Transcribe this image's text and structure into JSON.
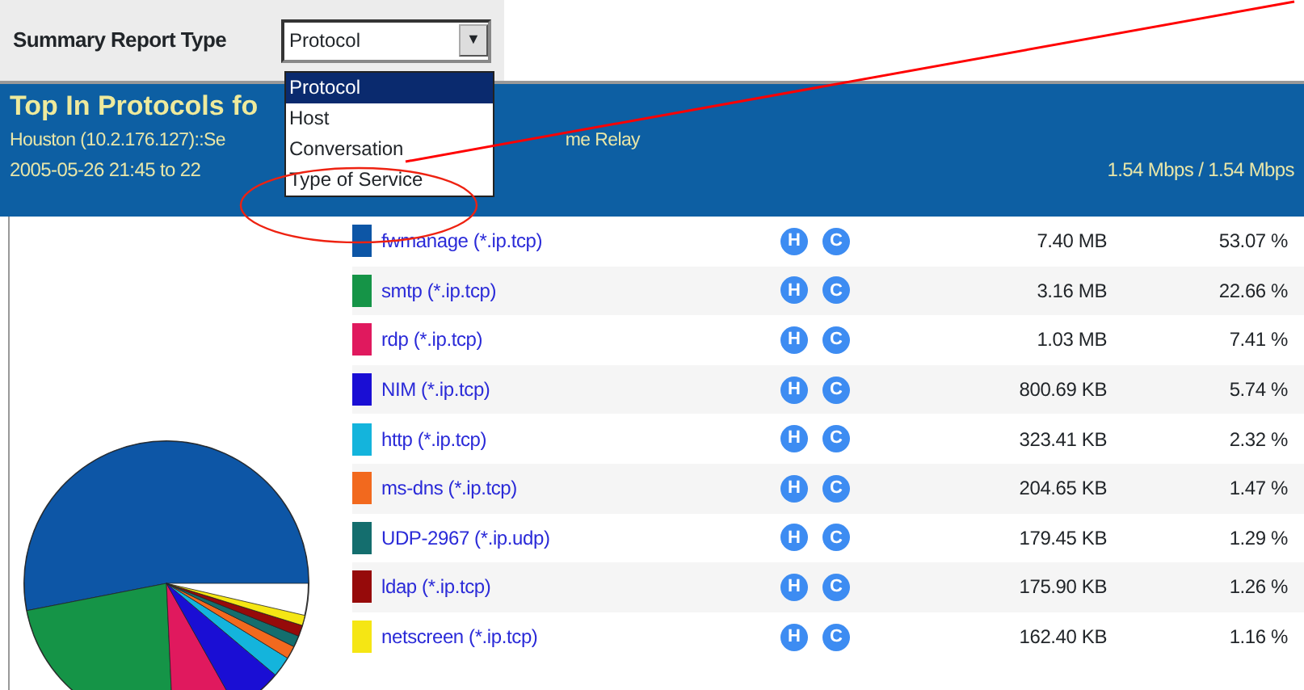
{
  "report_type": {
    "label": "Summary Report Type",
    "value": "Protocol",
    "arrow": "▼",
    "options": [
      {
        "label": "Protocol",
        "selected": true
      },
      {
        "label": "Host",
        "selected": false
      },
      {
        "label": "Conversation",
        "selected": false
      },
      {
        "label": "Type of Service",
        "selected": false
      }
    ]
  },
  "header": {
    "title": "Top In Protocols fo",
    "subtitle_left": "Houston (10.2.176.127)::Se",
    "subtitle_right": "me Relay",
    "date_range": "2005-05-26 21:45 to 22",
    "rate": "1.54 Mbps / 1.54 Mbps"
  },
  "rows": [
    {
      "name": "fwmanage (*.ip.tcp)",
      "color": "#0d56a6",
      "actions": [
        "H",
        "C"
      ],
      "volume": "7.40 MB",
      "percent": "53.07 %"
    },
    {
      "name": "smtp (*.ip.tcp)",
      "color": "#159447",
      "actions": [
        "H",
        "C"
      ],
      "volume": "3.16 MB",
      "percent": "22.66 %"
    },
    {
      "name": "rdp (*.ip.tcp)",
      "color": "#e0195e",
      "actions": [
        "H",
        "C"
      ],
      "volume": "1.03 MB",
      "percent": "7.41 %"
    },
    {
      "name": "NIM (*.ip.tcp)",
      "color": "#1a0ed4",
      "actions": [
        "H",
        "C"
      ],
      "volume": "800.69 KB",
      "percent": "5.74 %"
    },
    {
      "name": "http (*.ip.tcp)",
      "color": "#14b4dc",
      "actions": [
        "H",
        "C"
      ],
      "volume": "323.41 KB",
      "percent": "2.32 %"
    },
    {
      "name": "ms-dns (*.ip.tcp)",
      "color": "#f2691e",
      "actions": [
        "H",
        "C"
      ],
      "volume": "204.65 KB",
      "percent": "1.47 %"
    },
    {
      "name": "UDP-2967 (*.ip.udp)",
      "color": "#146e6e",
      "actions": [
        "H",
        "C"
      ],
      "volume": "179.45 KB",
      "percent": "1.29 %"
    },
    {
      "name": "ldap (*.ip.tcp)",
      "color": "#960a0a",
      "actions": [
        "H",
        "C"
      ],
      "volume": "175.90 KB",
      "percent": "1.26 %"
    },
    {
      "name": "netscreen (*.ip.tcp)",
      "color": "#f5e614",
      "actions": [
        "H",
        "C"
      ],
      "volume": "162.40 KB",
      "percent": "1.16 %"
    }
  ]
}
